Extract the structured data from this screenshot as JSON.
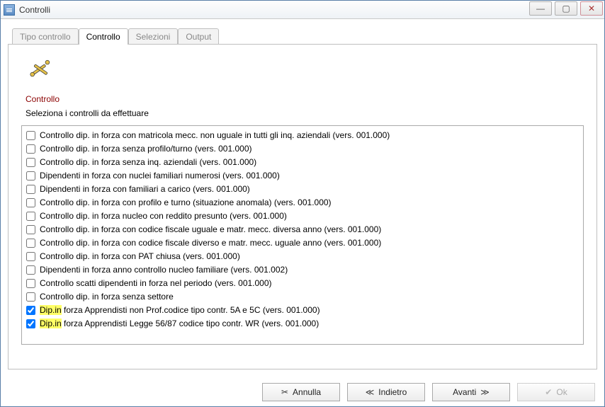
{
  "window": {
    "title": "Controlli"
  },
  "tabs": [
    {
      "label": "Tipo controllo",
      "active": false
    },
    {
      "label": "Controllo",
      "active": true
    },
    {
      "label": "Selezioni",
      "active": false
    },
    {
      "label": "Output",
      "active": false
    }
  ],
  "panel": {
    "section_title": "Controllo",
    "subtitle": "Seleziona i controlli da effettuare"
  },
  "items": [
    {
      "checked": false,
      "highlight": false,
      "label": "Controllo dip. in forza con matricola mecc. non uguale in tutti gli inq. aziendali (vers. 001.000)"
    },
    {
      "checked": false,
      "highlight": false,
      "label": "Controllo dip. in forza senza profilo/turno (vers. 001.000)"
    },
    {
      "checked": false,
      "highlight": false,
      "label": "Controllo dip. in forza senza inq. aziendali (vers. 001.000)"
    },
    {
      "checked": false,
      "highlight": false,
      "label": "Dipendenti in forza con nuclei familiari numerosi (vers. 001.000)"
    },
    {
      "checked": false,
      "highlight": false,
      "label": "Dipendenti in forza con familiari a carico (vers. 001.000)"
    },
    {
      "checked": false,
      "highlight": false,
      "label": "Controllo dip. in forza con profilo e turno (situazione anomala) (vers. 001.000)"
    },
    {
      "checked": false,
      "highlight": false,
      "label": "Controllo dip. in forza nucleo con reddito presunto (vers. 001.000)"
    },
    {
      "checked": false,
      "highlight": false,
      "label": "Controllo dip. in forza con codice fiscale uguale e matr. mecc. diversa anno (vers. 001.000)"
    },
    {
      "checked": false,
      "highlight": false,
      "label": "Controllo dip. in forza con codice fiscale diverso e matr. mecc. uguale anno (vers. 001.000)"
    },
    {
      "checked": false,
      "highlight": false,
      "label": "Controllo dip. in forza con PAT chiusa (vers. 001.000)"
    },
    {
      "checked": false,
      "highlight": false,
      "label": "Dipendenti in forza anno controllo nucleo familiare (vers. 001.002)"
    },
    {
      "checked": false,
      "highlight": false,
      "label": "Controllo scatti dipendenti in forza nel periodo (vers. 001.000)"
    },
    {
      "checked": false,
      "highlight": false,
      "label": "Controllo dip. in forza senza settore"
    },
    {
      "checked": true,
      "highlight": true,
      "hl_prefix": "Dip.in",
      "rest": " forza  Apprendisti non Prof.codice tipo contr. 5A   e 5C (vers. 001.000)"
    },
    {
      "checked": true,
      "highlight": true,
      "hl_prefix": "Dip.in",
      "rest": " forza  Apprendisti Legge 56/87 codice tipo contr. WR (vers. 001.000)"
    }
  ],
  "buttons": {
    "annulla": "Annulla",
    "indietro": "Indietro",
    "avanti": "Avanti",
    "ok": "Ok"
  }
}
